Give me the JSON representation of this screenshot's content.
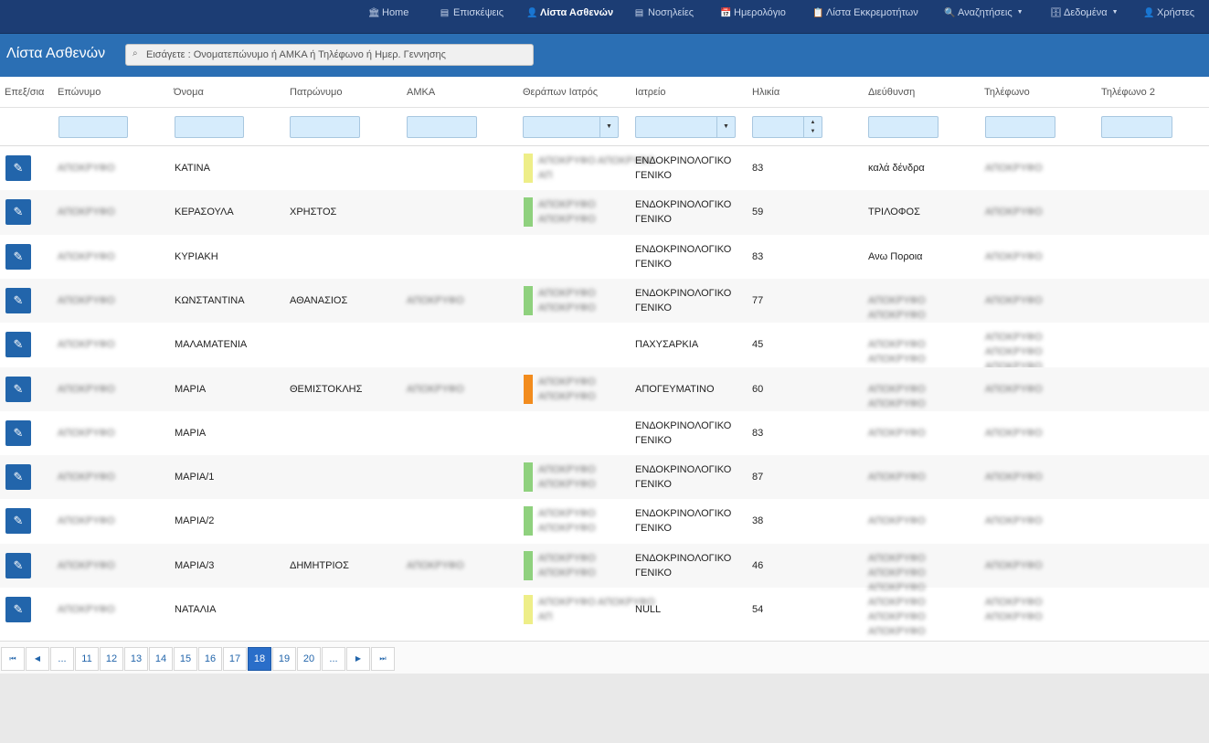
{
  "nav": {
    "items": [
      {
        "label": "Home",
        "icon": "bank-icon",
        "glyph": "🏛",
        "active": false,
        "dropdown": false
      },
      {
        "label": "Επισκέψεις",
        "icon": "file-icon",
        "glyph": "▤",
        "active": false,
        "dropdown": false
      },
      {
        "label": "Λίστα Ασθενών",
        "icon": "user-icon",
        "glyph": "👤",
        "active": true,
        "dropdown": false
      },
      {
        "label": "Νοσηλείες",
        "icon": "file-icon",
        "glyph": "▤",
        "active": false,
        "dropdown": false
      },
      {
        "label": "Ημερολόγιο",
        "icon": "calendar-icon",
        "glyph": "📅",
        "active": false,
        "dropdown": false
      },
      {
        "label": "Λίστα Εκκρεμοτήτων",
        "icon": "clipboard-icon",
        "glyph": "📋",
        "active": false,
        "dropdown": false
      },
      {
        "label": "Αναζητήσεις",
        "icon": "zoom-icon",
        "glyph": "🔍",
        "active": false,
        "dropdown": true
      },
      {
        "label": "Δεδομένα",
        "icon": "database-icon",
        "glyph": "🗄",
        "active": false,
        "dropdown": true
      },
      {
        "label": "Χρήστες",
        "icon": "user-icon",
        "glyph": "👤",
        "active": false,
        "dropdown": false
      }
    ]
  },
  "subbar": {
    "title": "Λίστα Ασθενών",
    "search_placeholder": "Εισάγετε : Ονοματεπώνυμο ή ΑΜΚΑ ή Τηλέφωνο ή Ημερ. Γεννησης"
  },
  "columns": [
    "Επεξ/σια",
    "Επώνυμο",
    "Όνομα",
    "Πατρώνυμο",
    "ΑΜΚΑ",
    "Θεράπων Ιατρός",
    "Ιατρείο",
    "Ηλικία",
    "Διεύθυνση",
    "Τηλέφωνο",
    "Τηλέφωνο 2"
  ],
  "colors": {
    "green": "#8fd17e",
    "yellow": "#eeee88",
    "orange": "#f28c1e",
    "accent": "#2265ab"
  },
  "rows": [
    {
      "surname": "ΑΠΟΚΡΥΦΟ",
      "name": "ΚΑΤΙΝΑ",
      "father": "",
      "amka": "",
      "doctor1": "ΑΠΟΚΡΥΦΟ ΑΠΟΚΡΥΦΟ",
      "doctor2": "ΑΠ",
      "bar": "yellow",
      "clinic": "ΕΝΔΟΚΡΙΝΟΛΟΓΙΚΟ ΓΕΝΙΚΟ",
      "age": "83",
      "address": "καλά δένδρα",
      "address_blur": false,
      "phone": "ΑΠΟΚΡΥΦΟ",
      "phone2": ""
    },
    {
      "surname": "ΑΠΟΚΡΥΦΟ",
      "name": "ΚΕΡΑΣΟΥΛΑ",
      "father": "ΧΡΗΣΤΟΣ",
      "amka": "",
      "doctor1": "ΑΠΟΚΡΥΦΟ",
      "doctor2": "ΑΠΟΚΡΥΦΟ",
      "bar": "green",
      "clinic": "ΕΝΔΟΚΡΙΝΟΛΟΓΙΚΟ ΓΕΝΙΚΟ",
      "age": "59",
      "address": "ΤΡΙΛΟΦΟΣ",
      "address_blur": false,
      "phone": "ΑΠΟΚΡΥΦΟ",
      "phone2": ""
    },
    {
      "surname": "ΑΠΟΚΡΥΦΟ",
      "name": "ΚΥΡΙΑΚΗ",
      "father": "",
      "amka": "",
      "doctor1": "",
      "doctor2": "",
      "bar": "",
      "clinic": "ΕΝΔΟΚΡΙΝΟΛΟΓΙΚΟ ΓΕΝΙΚΟ",
      "age": "83",
      "address": "Ανω Πορoια",
      "address_blur": false,
      "phone": "ΑΠΟΚΡΥΦΟ",
      "phone2": ""
    },
    {
      "surname": "ΑΠΟΚΡΥΦΟ",
      "name": "ΚΩΝΣΤΑΝΤΙΝΑ",
      "father": "ΑΘΑΝΑΣΙΟΣ",
      "amka": "ΑΠΟΚΡΥΦΟ",
      "doctor1": "ΑΠΟΚΡΥΦΟ",
      "doctor2": "ΑΠΟΚΡΥΦΟ",
      "bar": "green",
      "clinic": "ΕΝΔΟΚΡΙΝΟΛΟΓΙΚΟ ΓΕΝΙΚΟ",
      "age": "77",
      "address": "ΑΠΟΚΡΥΦΟ ΑΠΟΚΡΥΦΟ",
      "address_blur": true,
      "phone": "ΑΠΟΚΡΥΦΟ",
      "phone2": ""
    },
    {
      "surname": "ΑΠΟΚΡΥΦΟ",
      "name": "ΜΑΛΑΜΑΤΕΝΙΑ",
      "father": "",
      "amka": "",
      "doctor1": "",
      "doctor2": "",
      "bar": "",
      "clinic": "ΠΑΧΥΣΑΡΚΙΑ",
      "age": "45",
      "address": "ΑΠΟΚΡΥΦΟ ΑΠΟΚΡΥΦΟ",
      "address_blur": true,
      "phone": "ΑΠΟΚΡΥΦΟ ΑΠΟΚΡΥΦΟ ΑΠΟΚΡΥΦΟ",
      "phone2": ""
    },
    {
      "surname": "ΑΠΟΚΡΥΦΟ",
      "name": "ΜΑΡΙΑ",
      "father": "ΘΕΜΙΣΤΟΚΛΗΣ",
      "amka": "ΑΠΟΚΡΥΦΟ",
      "doctor1": "ΑΠΟΚΡΥΦΟ",
      "doctor2": "ΑΠΟΚΡΥΦΟ",
      "bar": "orange",
      "clinic": "ΑΠΟΓΕΥΜΑΤΙΝΟ",
      "age": "60",
      "address": "ΑΠΟΚΡΥΦΟ ΑΠΟΚΡΥΦΟ",
      "address_blur": true,
      "phone": "ΑΠΟΚΡΥΦΟ",
      "phone2": ""
    },
    {
      "surname": "ΑΠΟΚΡΥΦΟ",
      "name": "ΜΑΡΙΑ",
      "father": "",
      "amka": "",
      "doctor1": "",
      "doctor2": "",
      "bar": "",
      "clinic": "ΕΝΔΟΚΡΙΝΟΛΟΓΙΚΟ ΓΕΝΙΚΟ",
      "age": "83",
      "address": "ΑΠΟΚΡΥΦΟ",
      "address_blur": true,
      "phone": "ΑΠΟΚΡΥΦΟ",
      "phone2": ""
    },
    {
      "surname": "ΑΠΟΚΡΥΦΟ",
      "name": "ΜΑΡΙΑ/1",
      "father": "",
      "amka": "",
      "doctor1": "ΑΠΟΚΡΥΦΟ",
      "doctor2": "ΑΠΟΚΡΥΦΟ",
      "bar": "green",
      "clinic": "ΕΝΔΟΚΡΙΝΟΛΟΓΙΚΟ ΓΕΝΙΚΟ",
      "age": "87",
      "address": "ΑΠΟΚΡΥΦΟ",
      "address_blur": true,
      "phone": "ΑΠΟΚΡΥΦΟ",
      "phone2": ""
    },
    {
      "surname": "ΑΠΟΚΡΥΦΟ",
      "name": "ΜΑΡΙΑ/2",
      "father": "",
      "amka": "",
      "doctor1": "ΑΠΟΚΡΥΦΟ",
      "doctor2": "ΑΠΟΚΡΥΦΟ",
      "bar": "green",
      "clinic": "ΕΝΔΟΚΡΙΝΟΛΟΓΙΚΟ ΓΕΝΙΚΟ",
      "age": "38",
      "address": "ΑΠΟΚΡΥΦΟ",
      "address_blur": true,
      "phone": "ΑΠΟΚΡΥΦΟ",
      "phone2": ""
    },
    {
      "surname": "ΑΠΟΚΡΥΦΟ",
      "name": "ΜΑΡΙΑ/3",
      "father": "ΔΗΜΗΤΡΙΟΣ",
      "amka": "ΑΠΟΚΡΥΦΟ",
      "doctor1": "ΑΠΟΚΡΥΦΟ",
      "doctor2": "ΑΠΟΚΡΥΦΟ",
      "bar": "green",
      "clinic": "ΕΝΔΟΚΡΙΝΟΛΟΓΙΚΟ ΓΕΝΙΚΟ",
      "age": "46",
      "address": "ΑΠΟΚΡΥΦΟ ΑΠΟΚΡΥΦΟ ΑΠΟΚΡΥΦΟ",
      "address_blur": true,
      "phone": "ΑΠΟΚΡΥΦΟ",
      "phone2": ""
    },
    {
      "surname": "ΑΠΟΚΡΥΦΟ",
      "name": "ΝΑΤΑΛΙΑ",
      "father": "",
      "amka": "",
      "doctor1": "ΑΠΟΚΡΥΦΟ ΑΠΟΚΡΥΦΟ",
      "doctor2": "ΑΠ",
      "bar": "yellow",
      "clinic": "NULL",
      "age": "54",
      "address": "ΑΠΟΚΡΥΦΟ ΑΠΟΚΡΥΦΟ ΑΠΟΚΡΥΦΟ",
      "address_blur": true,
      "phone": "ΑΠΟΚΡΥΦΟ ΑΠΟΚΡΥΦΟ",
      "phone2": ""
    }
  ],
  "pager": {
    "first": "⏮",
    "prev": "◀",
    "next": "▶",
    "last": "⏭",
    "pages": [
      "...",
      "11",
      "12",
      "13",
      "14",
      "15",
      "16",
      "17",
      "18",
      "19",
      "20",
      "..."
    ],
    "current": "18"
  }
}
